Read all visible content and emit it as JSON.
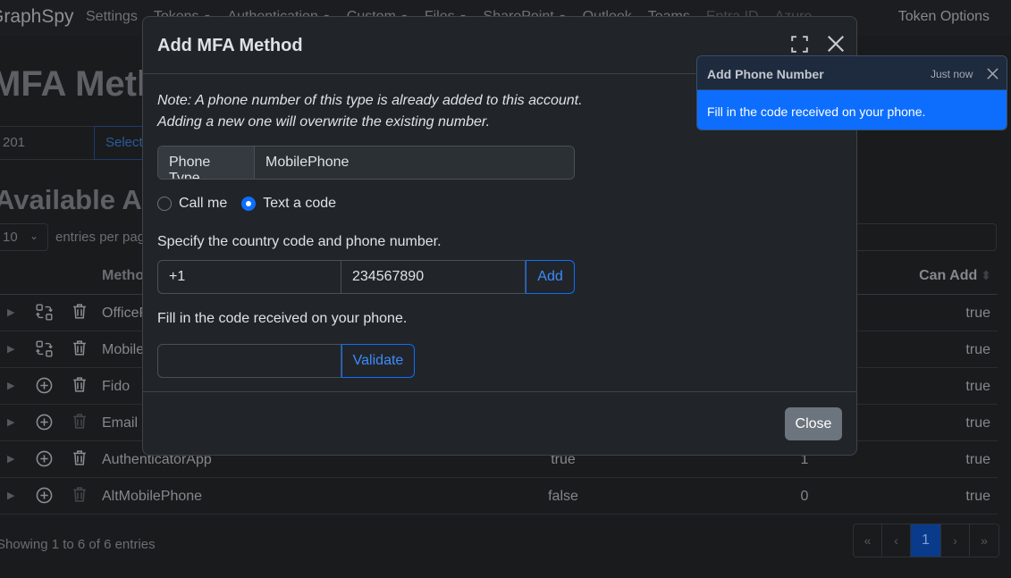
{
  "navbar": {
    "brand": "GraphSpy",
    "items": [
      {
        "label": "Settings",
        "dropdown": false
      },
      {
        "label": "Tokens",
        "dropdown": true
      },
      {
        "label": "Authentication",
        "dropdown": true
      },
      {
        "label": "Custom",
        "dropdown": true
      },
      {
        "label": "Files",
        "dropdown": true
      },
      {
        "label": "SharePoint",
        "dropdown": true
      },
      {
        "label": "Outlook",
        "dropdown": false
      },
      {
        "label": "Teams",
        "dropdown": false
      },
      {
        "label": "Entra ID",
        "dropdown": false
      },
      {
        "label": "Azure",
        "dropdown": false
      }
    ],
    "right": "Token Options"
  },
  "page": {
    "title": "MFA Methods",
    "tenant_value": "201",
    "select_label": "Select",
    "section_title": "Available Authentication Methods",
    "entries_value": "10",
    "entries_label": "entries per page"
  },
  "table": {
    "headers": {
      "method": "Method",
      "can_add": "Can Add"
    },
    "rows": [
      {
        "name": "OfficePhone",
        "registered": "",
        "count": "",
        "can_add": "true",
        "icon1": "swap-icon",
        "delete_enabled": true
      },
      {
        "name": "MobilePhone",
        "registered": "",
        "count": "",
        "can_add": "true",
        "icon1": "swap-icon",
        "delete_enabled": true
      },
      {
        "name": "Fido",
        "registered": "",
        "count": "",
        "can_add": "true",
        "icon1": "plus-circle-icon",
        "delete_enabled": true
      },
      {
        "name": "Email",
        "registered": "",
        "count": "",
        "can_add": "true",
        "icon1": "plus-circle-icon",
        "delete_enabled": false
      },
      {
        "name": "AuthenticatorApp",
        "registered": "true",
        "count": "1",
        "can_add": "true",
        "icon1": "plus-circle-icon",
        "delete_enabled": true
      },
      {
        "name": "AltMobilePhone",
        "registered": "false",
        "count": "0",
        "can_add": "true",
        "icon1": "plus-circle-icon",
        "delete_enabled": false
      }
    ],
    "info": "Showing 1 to 6 of 6 entries",
    "pagination": [
      "«",
      "‹",
      "1",
      "›",
      "»"
    ],
    "current_page": "1"
  },
  "modal": {
    "title": "Add MFA Method",
    "note_line1": "Note: A phone number of this type is already added to this account.",
    "note_line2": "Adding a new one will overwrite the existing number.",
    "phone_type_label": "Phone Type",
    "phone_type_value": "MobilePhone",
    "radio_call": "Call me",
    "radio_text": "Text a code",
    "selected_radio": "Text a code",
    "country_label": "Specify the country code and phone number.",
    "country_code": "+1",
    "phone_number": "234567890",
    "add_label": "Add",
    "code_label": "Fill in the code received on your phone.",
    "code_value": "",
    "validate_label": "Validate",
    "close_label": "Close"
  },
  "toast": {
    "title": "Add Phone Number",
    "time": "Just now",
    "body": "Fill in the code received on your phone."
  },
  "colors": {
    "accent": "#0d6efd",
    "modal_bg": "#212529",
    "page_bg": "#1a1b1d",
    "close_button": "#6c757d"
  }
}
